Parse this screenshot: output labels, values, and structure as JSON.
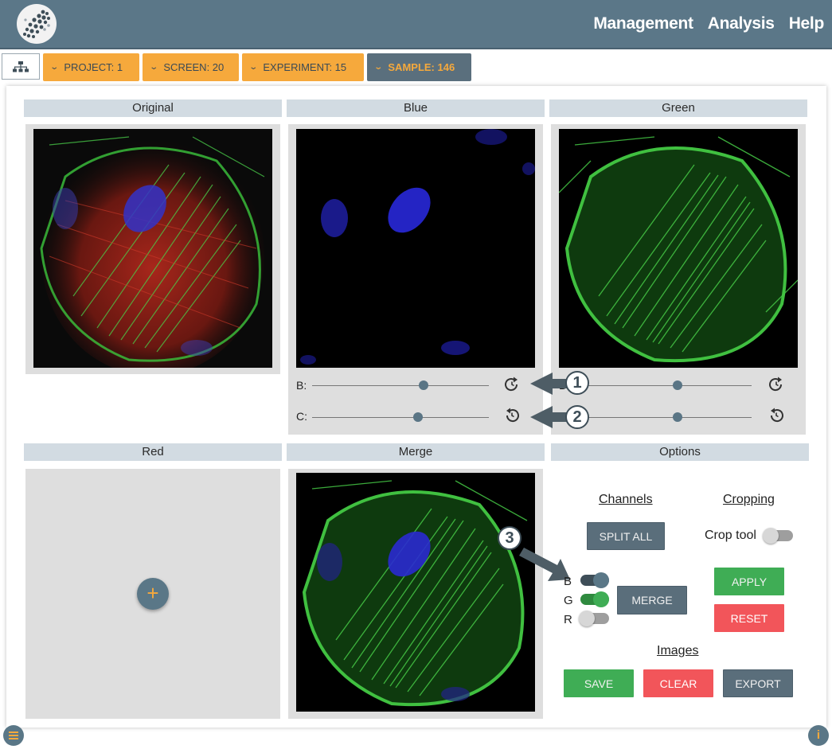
{
  "header": {
    "nav": [
      "Management",
      "Analysis",
      "Help"
    ]
  },
  "breadcrumb": {
    "items": [
      {
        "label": "PROJECT: 1"
      },
      {
        "label": "SCREEN: 20"
      },
      {
        "label": "EXPERIMENT: 15"
      },
      {
        "label": "SAMPLE: 146"
      }
    ]
  },
  "panels": {
    "original": "Original",
    "blue": "Blue",
    "green": "Green",
    "red": "Red",
    "merge": "Merge",
    "options": "Options"
  },
  "sliders": {
    "b_label": "B:",
    "c_label": "C:",
    "blue_brightness": 0.63,
    "blue_contrast": 0.6,
    "green_brightness": 0.58,
    "green_contrast": 0.58
  },
  "callouts": [
    "1",
    "2",
    "3"
  ],
  "options": {
    "channels_heading": "Channels",
    "cropping_heading": "Cropping",
    "images_heading": "Images",
    "split_all": "SPLIT ALL",
    "crop_tool_label": "Crop tool",
    "crop_tool_on": false,
    "merge": "MERGE",
    "apply": "APPLY",
    "reset": "RESET",
    "save": "SAVE",
    "clear": "CLEAR",
    "export": "EXPORT",
    "channel_toggles": [
      {
        "label": "B",
        "on": true
      },
      {
        "label": "G",
        "on": true
      },
      {
        "label": "R",
        "on": false
      }
    ]
  },
  "red_panel": {
    "add_symbol": "+"
  },
  "corner": {
    "info_symbol": "i"
  },
  "colors": {
    "header": "#5b7788",
    "accent_orange": "#f6a93c",
    "slate": "#5a6e7b",
    "green": "#3fad55",
    "red": "#f2555a"
  },
  "icons": [
    "logo",
    "hierarchy-icon",
    "chevron-down-icon",
    "refresh-icon",
    "history-icon",
    "plus-icon",
    "menu-icon",
    "info-icon",
    "arrow-icon"
  ]
}
